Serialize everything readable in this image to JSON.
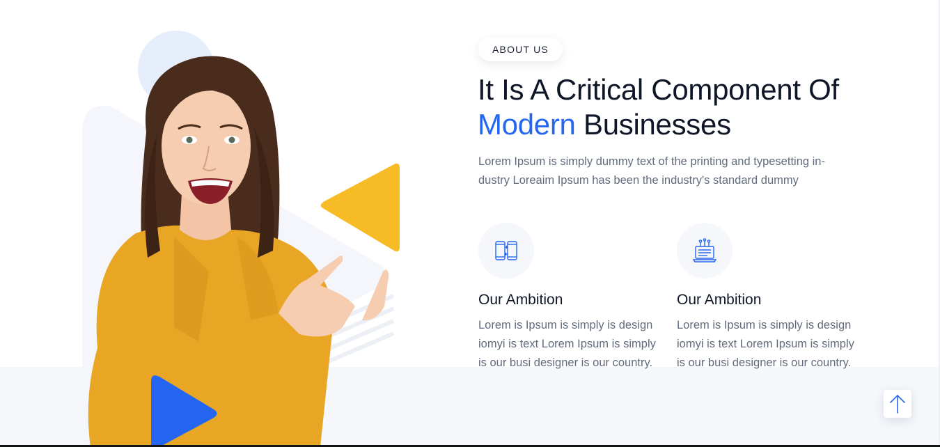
{
  "about": {
    "badge": "ABOUT US",
    "headline_part1": "It Is A Critical Component Of",
    "headline_accent": "Modern",
    "headline_part2": "Businesses",
    "intro": "Lorem Ipsum is simply dummy text of the printing and typesetting in-dustry Loreaim Ipsum has been the industry's standard dummy"
  },
  "features": [
    {
      "icon": "mobile-devices-icon",
      "title": "Our Ambition",
      "text": "Lorem is Ipsum is simply is design iomyi is text Lorem Ipsum is simply is our busi designer is our country."
    },
    {
      "icon": "laptop-network-icon",
      "title": "Our Ambition",
      "text": "Lorem is Ipsum is simply is design iomyi is text Lorem Ipsum is simply is our busi designer is our country."
    }
  ],
  "colors": {
    "accent_blue": "#2566f0",
    "accent_yellow": "#f6bb25",
    "shirt_yellow": "#e8a624",
    "light_circle": "#e6eefc",
    "band": "#f5f7fb"
  },
  "scroll_top": {
    "icon": "arrow-up-icon"
  },
  "hero_image": {
    "subject": "smiling-woman-pointing-photo"
  }
}
